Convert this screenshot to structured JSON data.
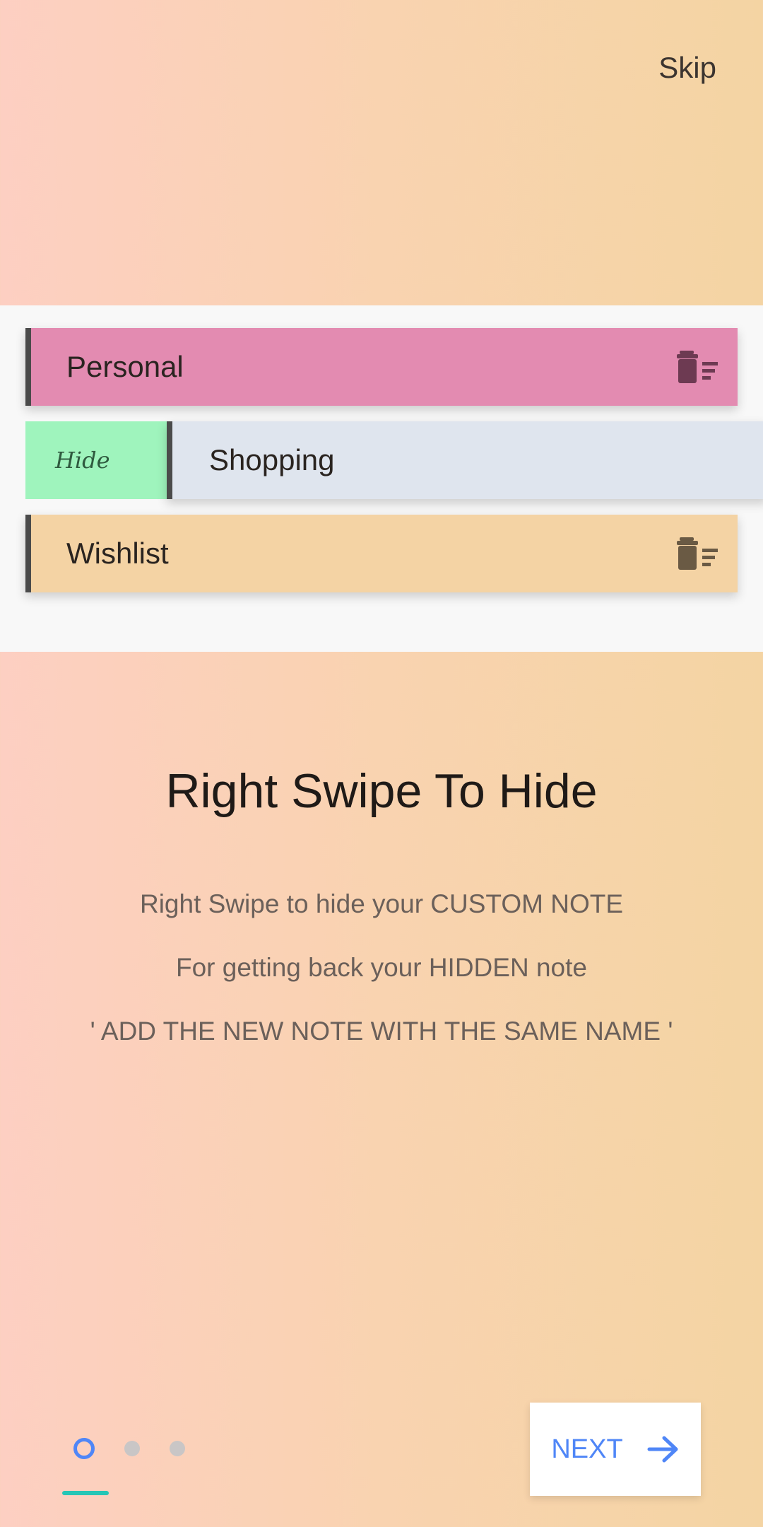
{
  "header": {
    "skip_label": "Skip"
  },
  "preview": {
    "notes": [
      {
        "label": "Personal",
        "color": "#e38bb1"
      },
      {
        "label": "Shopping",
        "color": "#dfe5ee"
      },
      {
        "label": "Wishlist",
        "color": "#f4d3a4"
      }
    ],
    "hide_action_label": "Hide",
    "hide_action_color": "#9ff4bd"
  },
  "content": {
    "title": "Right Swipe To Hide",
    "lines": [
      "Right Swipe to hide your CUSTOM NOTE",
      "For getting back your HIDDEN note",
      "' ADD THE NEW NOTE WITH THE SAME NAME '"
    ]
  },
  "pager": {
    "active_page": 1,
    "page_count": 3
  },
  "footer": {
    "next_label": "NEXT",
    "accent": "#4f86f7"
  }
}
